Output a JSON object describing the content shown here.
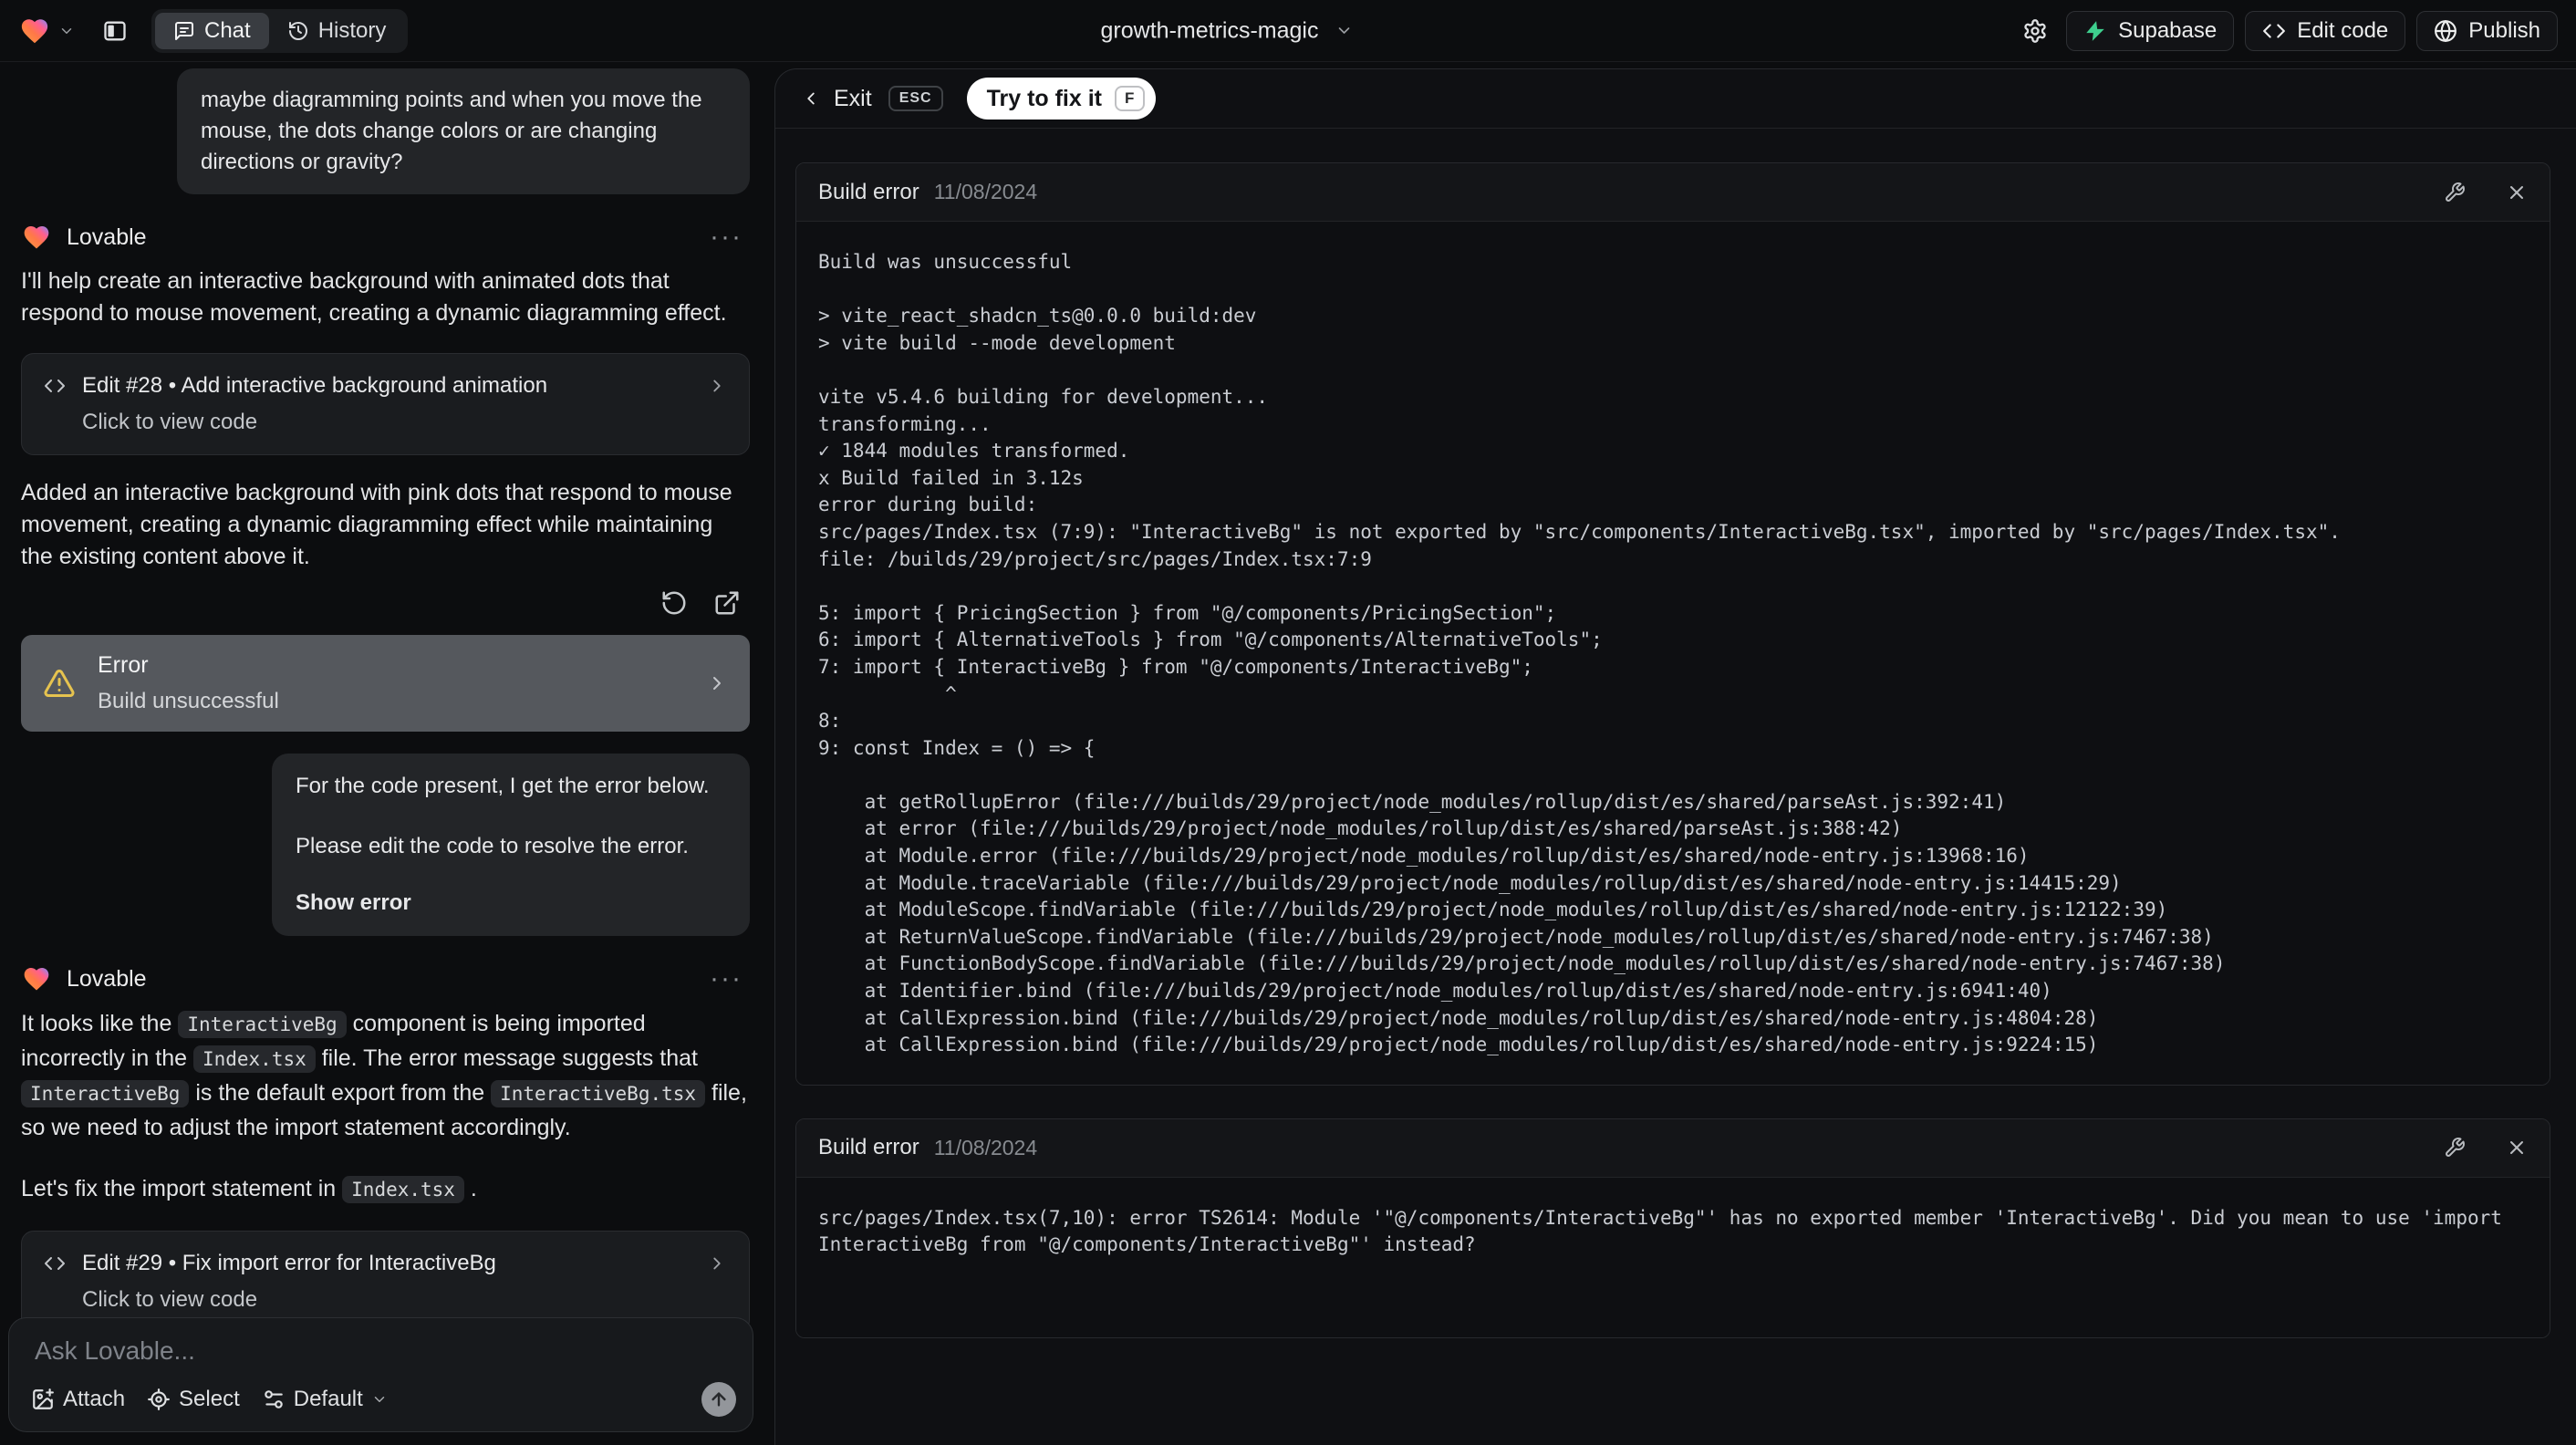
{
  "topbar": {
    "project_name": "growth-metrics-magic",
    "chat_tab": "Chat",
    "history_tab": "History",
    "supabase_label": "Supabase",
    "edit_code_label": "Edit code",
    "publish_label": "Publish"
  },
  "colors": {
    "supabase_green": "#3ecf8e",
    "warning_yellow": "#e6c34f",
    "fix_button_bg": "#ffffff",
    "error_card_gray": "#55585d"
  },
  "chat": {
    "assistant_name": "Lovable",
    "menu_ellipsis": "···",
    "user_message_1": "maybe diagramming points and when you move the mouse, the dots change colors or are changing directions or gravity?",
    "assistant_message_1": "I'll help create an interactive background with animated dots that respond to mouse movement, creating a dynamic diagramming effect.",
    "edit_card_1": {
      "title": "Edit #28 • Add interactive background animation",
      "subtitle": "Click to view code"
    },
    "assistant_message_2": "Added an interactive background with pink dots that respond to mouse movement, creating a dynamic diagramming effect while maintaining the existing content above it.",
    "error_card": {
      "title": "Error",
      "subtitle": "Build unsuccessful"
    },
    "user_message_2": {
      "line1": "For the code present, I get the error below.",
      "line2": "Please edit the code to resolve the error.",
      "action": "Show error"
    },
    "assistant_message_3_segments": [
      {
        "t": "It looks like the "
      },
      {
        "c": "InteractiveBg"
      },
      {
        "t": " component is being imported incorrectly in the "
      },
      {
        "c": "Index.tsx"
      },
      {
        "t": " file. The error message suggests that "
      },
      {
        "c": "InteractiveBg"
      },
      {
        "t": " is the default export from the "
      },
      {
        "c": "InteractiveBg.tsx"
      },
      {
        "t": " file, so we need to adjust the import statement accordingly."
      }
    ],
    "assistant_message_4_segments": [
      {
        "t": "Let's fix the import statement in "
      },
      {
        "c": "Index.tsx"
      },
      {
        "t": " ."
      }
    ],
    "edit_card_2": {
      "title": "Edit #29 • Fix import error for InteractiveBg",
      "subtitle": "Click to view code"
    },
    "input": {
      "placeholder": "Ask Lovable...",
      "attach_label": "Attach",
      "select_label": "Select",
      "mode_label": "Default"
    }
  },
  "fix_overlay": {
    "exit_label": "Exit",
    "esc_key": "ESC",
    "fix_button_label": "Try to fix it",
    "fix_key": "F"
  },
  "error_panels": [
    {
      "title": "Build error",
      "date": "11/08/2024",
      "log_lines": [
        "Build was unsuccessful",
        "",
        "> vite_react_shadcn_ts@0.0.0 build:dev",
        "> vite build --mode development",
        "",
        "vite v5.4.6 building for development...",
        "transforming...",
        "✓ 1844 modules transformed.",
        "x Build failed in 3.12s",
        "error during build:",
        "src/pages/Index.tsx (7:9): \"InteractiveBg\" is not exported by \"src/components/InteractiveBg.tsx\", imported by \"src/pages/Index.tsx\".",
        "file: /builds/29/project/src/pages/Index.tsx:7:9",
        "",
        "5: import { PricingSection } from \"@/components/PricingSection\";",
        "6: import { AlternativeTools } from \"@/components/AlternativeTools\";",
        "7: import { InteractiveBg } from \"@/components/InteractiveBg\";",
        "           ^",
        "8:",
        "9: const Index = () => {",
        "",
        "    at getRollupError (file:///builds/29/project/node_modules/rollup/dist/es/shared/parseAst.js:392:41)",
        "    at error (file:///builds/29/project/node_modules/rollup/dist/es/shared/parseAst.js:388:42)",
        "    at Module.error (file:///builds/29/project/node_modules/rollup/dist/es/shared/node-entry.js:13968:16)",
        "    at Module.traceVariable (file:///builds/29/project/node_modules/rollup/dist/es/shared/node-entry.js:14415:29)",
        "    at ModuleScope.findVariable (file:///builds/29/project/node_modules/rollup/dist/es/shared/node-entry.js:12122:39)",
        "    at ReturnValueScope.findVariable (file:///builds/29/project/node_modules/rollup/dist/es/shared/node-entry.js:7467:38)",
        "    at FunctionBodyScope.findVariable (file:///builds/29/project/node_modules/rollup/dist/es/shared/node-entry.js:7467:38)",
        "    at Identifier.bind (file:///builds/29/project/node_modules/rollup/dist/es/shared/node-entry.js:6941:40)",
        "    at CallExpression.bind (file:///builds/29/project/node_modules/rollup/dist/es/shared/node-entry.js:4804:28)",
        "    at CallExpression.bind (file:///builds/29/project/node_modules/rollup/dist/es/shared/node-entry.js:9224:15)"
      ]
    },
    {
      "title": "Build error",
      "date": "11/08/2024",
      "log_lines": [
        "src/pages/Index.tsx(7,10): error TS2614: Module '\"@/components/InteractiveBg\"' has no exported member 'InteractiveBg'. Did you mean to use 'import InteractiveBg from \"@/components/InteractiveBg\"' instead?"
      ]
    }
  ]
}
